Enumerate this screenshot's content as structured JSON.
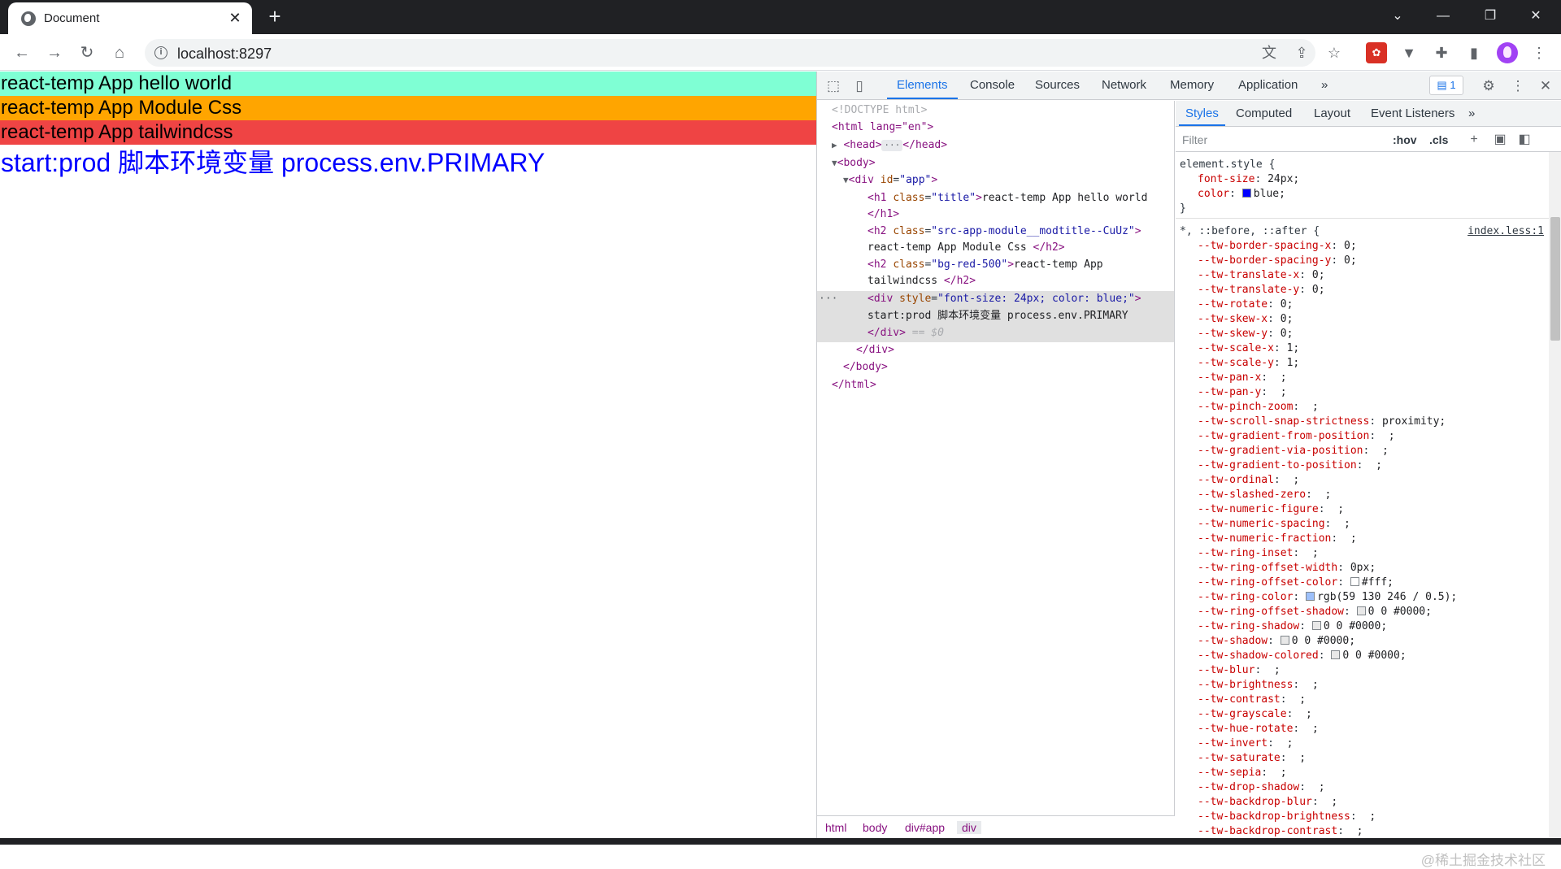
{
  "browser": {
    "tab_title": "Document",
    "tab_close": "✕",
    "new_tab": "+",
    "url": "localhost:8297",
    "window_controls": [
      "⌄",
      "—",
      "❐",
      "✕"
    ],
    "icons": [
      "globe-icon",
      "back-icon",
      "forward-icon",
      "reload-icon",
      "home-icon",
      "info-icon",
      "translate-icon",
      "share-icon",
      "star-icon",
      "extension-red-icon",
      "extension-v-icon",
      "puzzle-icon",
      "sidebar-icon",
      "avatar",
      "kebab-menu-icon"
    ]
  },
  "page": {
    "h1": "react-temp App hello world",
    "h2_module": "react-temp App Module Css",
    "h2_tailwind": "react-temp App tailwindcss",
    "primary_div": "start:prod 脚本环境变量 process.env.PRIMARY",
    "colors": {
      "aquamarine": "#7fffd4",
      "orange": "#ffa500",
      "red500": "#ef4444",
      "blue": "#0000ff"
    }
  },
  "devtools": {
    "tabs": [
      "Elements",
      "Console",
      "Sources",
      "Network",
      "Memory",
      "Application"
    ],
    "more_tabs": "»",
    "issues_count": "1",
    "dom": {
      "doctype": "<!DOCTYPE html>",
      "html_open": "<html lang=\"en\">",
      "head": "<head>",
      "head_close": "</head>",
      "head_ellipsis": "···",
      "body_open": "<body>",
      "div_app_open_tag": "<div",
      "div_app_attr": "id",
      "div_app_val": "\"app\"",
      "h1_tag": "<h1",
      "h1_attr": "class",
      "h1_val": "\"title\"",
      "h1_text": "react-temp App hello world",
      "h1_close": "</h1>",
      "h2a_tag": "<h2",
      "h2a_attr": "class",
      "h2a_val": "\"src-app-module__modtitle--CuUz\"",
      "h2a_text": "react-temp App Module Css ",
      "h2a_close": "</h2>",
      "h2b_tag": "<h2",
      "h2b_attr": "class",
      "h2b_val": "\"bg-red-500\"",
      "h2b_text1": "react-temp App",
      "h2b_text2": "tailwindcss ",
      "h2b_close": "</h2>",
      "div_sel_tag": "<div",
      "div_sel_attr": "style",
      "div_sel_val": "\"font-size: 24px; color: blue;\"",
      "div_sel_text": "start:prod 脚本环境变量 process.env.PRIMARY",
      "div_sel_close": "</div>",
      "div_sel_eq": " == $0",
      "div_app_close": "</div>",
      "body_close": "</body>",
      "html_close": "</html>",
      "dots": "···"
    },
    "breadcrumbs": [
      "html",
      "body",
      "div#app",
      "div"
    ],
    "styles_tabs": [
      "Styles",
      "Computed",
      "Layout",
      "Event Listeners"
    ],
    "styles_more": "»",
    "filter_placeholder": "Filter",
    "hov": ":hov",
    ".cls": ".cls",
    "element_style": {
      "selector": "element.style {",
      "props": [
        {
          "name": "font-size",
          "value": "24px;"
        },
        {
          "name": "color",
          "value": "blue;",
          "swatch": "#0000ff"
        }
      ],
      "close": "}"
    },
    "universal_rule": {
      "selector": "*, ::before, ::after {",
      "source": "index.less:1",
      "props": [
        {
          "name": "--tw-border-spacing-x",
          "value": "0;"
        },
        {
          "name": "--tw-border-spacing-y",
          "value": "0;"
        },
        {
          "name": "--tw-translate-x",
          "value": "0;"
        },
        {
          "name": "--tw-translate-y",
          "value": "0;"
        },
        {
          "name": "--tw-rotate",
          "value": "0;"
        },
        {
          "name": "--tw-skew-x",
          "value": "0;"
        },
        {
          "name": "--tw-skew-y",
          "value": "0;"
        },
        {
          "name": "--tw-scale-x",
          "value": "1;"
        },
        {
          "name": "--tw-scale-y",
          "value": "1;"
        },
        {
          "name": "--tw-pan-x",
          "value": " ;"
        },
        {
          "name": "--tw-pan-y",
          "value": " ;"
        },
        {
          "name": "--tw-pinch-zoom",
          "value": " ;"
        },
        {
          "name": "--tw-scroll-snap-strictness",
          "value": "proximity;"
        },
        {
          "name": "--tw-gradient-from-position",
          "value": " ;"
        },
        {
          "name": "--tw-gradient-via-position",
          "value": " ;"
        },
        {
          "name": "--tw-gradient-to-position",
          "value": " ;"
        },
        {
          "name": "--tw-ordinal",
          "value": " ;"
        },
        {
          "name": "--tw-slashed-zero",
          "value": " ;"
        },
        {
          "name": "--tw-numeric-figure",
          "value": " ;"
        },
        {
          "name": "--tw-numeric-spacing",
          "value": " ;"
        },
        {
          "name": "--tw-numeric-fraction",
          "value": " ;"
        },
        {
          "name": "--tw-ring-inset",
          "value": " ;"
        },
        {
          "name": "--tw-ring-offset-width",
          "value": "0px;"
        },
        {
          "name": "--tw-ring-offset-color",
          "value": "#fff;",
          "swatch": "#ffffff"
        },
        {
          "name": "--tw-ring-color",
          "value": "rgb(59 130 246 / 0.5);",
          "swatch": "#9dc0fa"
        },
        {
          "name": "--tw-ring-offset-shadow",
          "value": "0 0 #0000;",
          "swatch": "#e8e8e8"
        },
        {
          "name": "--tw-ring-shadow",
          "value": "0 0 #0000;",
          "swatch": "#e8e8e8"
        },
        {
          "name": "--tw-shadow",
          "value": "0 0 #0000;",
          "swatch": "#e8e8e8"
        },
        {
          "name": "--tw-shadow-colored",
          "value": "0 0 #0000;",
          "swatch": "#e8e8e8"
        },
        {
          "name": "--tw-blur",
          "value": " ;"
        },
        {
          "name": "--tw-brightness",
          "value": " ;"
        },
        {
          "name": "--tw-contrast",
          "value": " ;"
        },
        {
          "name": "--tw-grayscale",
          "value": " ;"
        },
        {
          "name": "--tw-hue-rotate",
          "value": " ;"
        },
        {
          "name": "--tw-invert",
          "value": " ;"
        },
        {
          "name": "--tw-saturate",
          "value": " ;"
        },
        {
          "name": "--tw-sepia",
          "value": " ;"
        },
        {
          "name": "--tw-drop-shadow",
          "value": " ;"
        },
        {
          "name": "--tw-backdrop-blur",
          "value": " ;"
        },
        {
          "name": "--tw-backdrop-brightness",
          "value": " ;"
        },
        {
          "name": "--tw-backdrop-contrast",
          "value": " ;"
        }
      ]
    },
    "watermark": "@稀土掘金技术社区"
  }
}
